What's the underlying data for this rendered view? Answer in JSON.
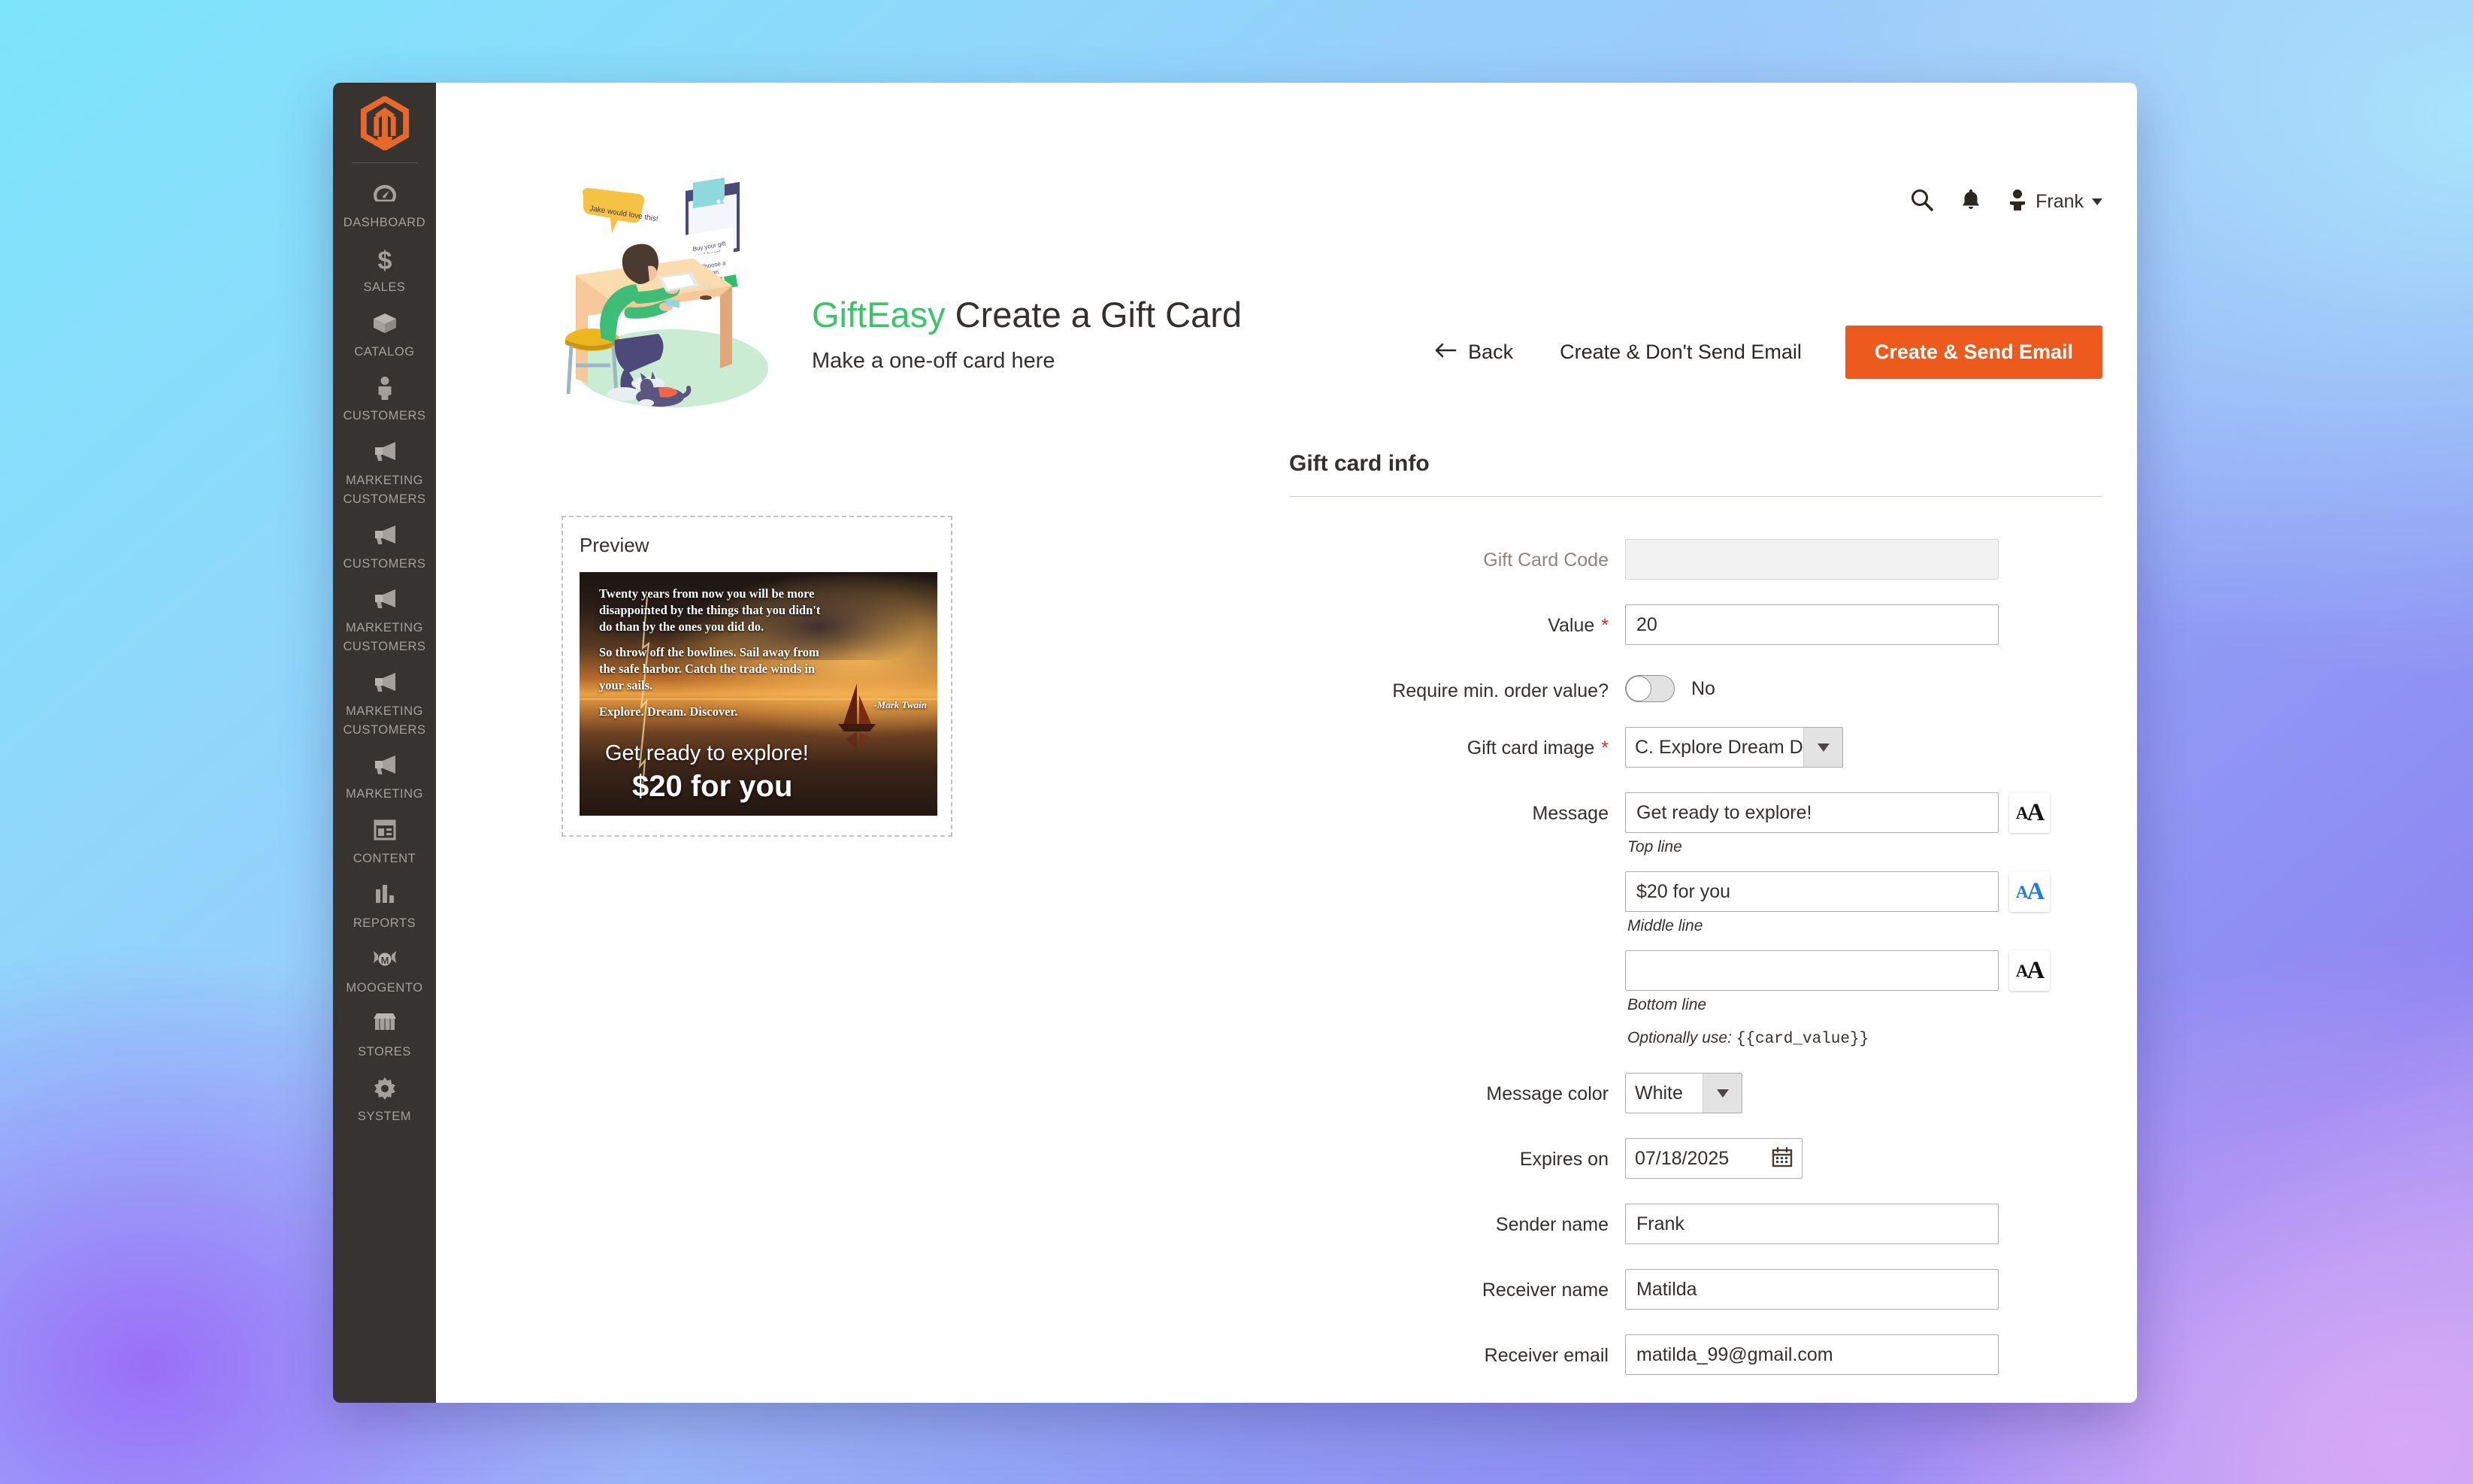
{
  "sidebar": {
    "logo": "magento-logo",
    "items": [
      {
        "label": "DASHBOARD",
        "icon": "gauge-icon"
      },
      {
        "label": "SALES",
        "icon": "dollar-icon"
      },
      {
        "label": "CATALOG",
        "icon": "box-icon"
      },
      {
        "label": "CUSTOMERS",
        "icon": "person-icon"
      },
      {
        "label": "MARKETING\nCUSTOMERS",
        "icon": "megaphone-icon"
      },
      {
        "label": "CUSTOMERS",
        "icon": "megaphone-icon"
      },
      {
        "label": "MARKETING\nCUSTOMERS",
        "icon": "megaphone-icon"
      },
      {
        "label": "MARKETING\nCUSTOMERS",
        "icon": "megaphone-icon"
      },
      {
        "label": "MARKETING",
        "icon": "megaphone-icon"
      },
      {
        "label": "CONTENT",
        "icon": "layout-icon"
      },
      {
        "label": "REPORTS",
        "icon": "bar-chart-icon"
      },
      {
        "label": "MOOGENTO",
        "icon": "candy-icon"
      },
      {
        "label": "STORES",
        "icon": "storefront-icon"
      },
      {
        "label": "SYSTEM",
        "icon": "gear-icon"
      }
    ]
  },
  "topbar": {
    "search_icon": "search-icon",
    "notifications_icon": "bell-icon",
    "user_icon": "avatar-icon",
    "user_name": "Frank",
    "caret_icon": "chevron-down-icon"
  },
  "header": {
    "brand": "GiftEasy",
    "title": "Create a Gift Card",
    "subtitle": "Make a one-off card here",
    "back_label": "Back",
    "back_icon": "arrow-left-icon",
    "secondary_label": "Create & Don't Send Email",
    "primary_label": "Create & Send Email",
    "primary_color": "#ec5b1d",
    "brand_color": "#3ac569"
  },
  "preview": {
    "label": "Preview",
    "quote_paragraphs": [
      "Twenty years from now you will be more disappointed by the things that you didn't do than by the ones you did do.",
      "So throw off the bowlines. Sail away from the safe harbor. Catch the trade winds in your sails.",
      "Explore. Dream. Discover."
    ],
    "attribution": "-Mark Twain",
    "message_top": "Get ready to explore!",
    "message_middle": "$20 for you"
  },
  "form": {
    "section_title": "Gift card info",
    "gift_card_code": {
      "label": "Gift Card Code",
      "value": "",
      "disabled": true
    },
    "value": {
      "label": "Value",
      "value": "20",
      "required": true
    },
    "require_min_order": {
      "label": "Require min. order value?",
      "state": "No",
      "on": false
    },
    "gift_card_image": {
      "label": "Gift card image",
      "selected": "C. Explore Dream Discover",
      "required": true
    },
    "message": {
      "label": "Message",
      "top": {
        "value": "Get ready to explore!",
        "help": "Top line",
        "font_icon": "font-size-icon",
        "font_active": false
      },
      "middle": {
        "value": "$20 for you",
        "help": "Middle line",
        "font_icon": "font-size-icon",
        "font_active": true
      },
      "bottom": {
        "value": "",
        "help": "Bottom line",
        "font_icon": "font-size-icon",
        "font_active": false
      },
      "hint_prefix": "Optionally use:",
      "hint_code": "{{card_value}}"
    },
    "message_color": {
      "label": "Message color",
      "selected": "White"
    },
    "expires_on": {
      "label": "Expires on",
      "value": "07/18/2025",
      "icon": "calendar-icon"
    },
    "sender_name": {
      "label": "Sender name",
      "value": "Frank"
    },
    "receiver_name": {
      "label": "Receiver name",
      "value": "Matilda"
    },
    "receiver_email": {
      "label": "Receiver email",
      "value": "matilda_99@gmail.com"
    }
  }
}
